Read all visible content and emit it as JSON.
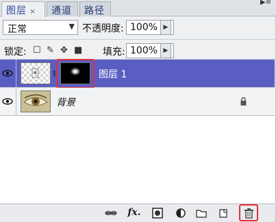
{
  "tabs": [
    {
      "label": "图层",
      "close": "×"
    },
    {
      "label": "通道"
    },
    {
      "label": "路径"
    }
  ],
  "panel_menu": "▶≡",
  "blend_mode": {
    "value": "正常"
  },
  "opacity": {
    "label": "不透明度:",
    "value": "100%"
  },
  "lock": {
    "label": "锁定:"
  },
  "fill": {
    "label": "填充:",
    "value": "100%"
  },
  "layers": [
    {
      "name": "图层 1",
      "selected": true,
      "has_mask": true
    },
    {
      "name": "背景",
      "selected": false,
      "locked": true
    }
  ],
  "colors": {
    "selection": "#5a5ec2",
    "highlight": "#e0303a"
  }
}
